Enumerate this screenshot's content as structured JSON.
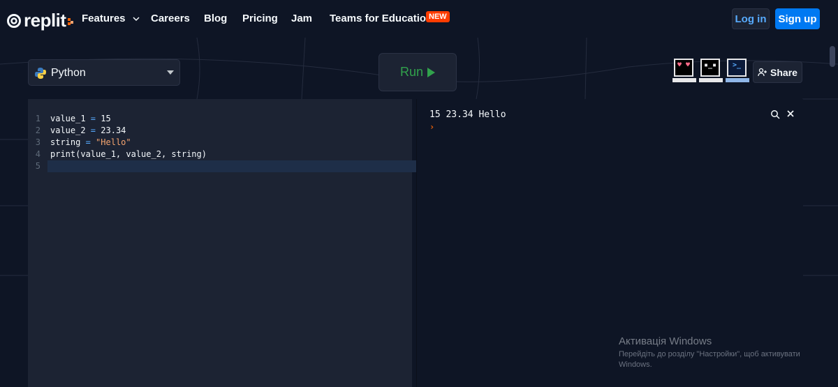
{
  "nav": {
    "logo_text": "replit",
    "links": {
      "features": "Features",
      "careers": "Careers",
      "blog": "Blog",
      "pricing": "Pricing",
      "jam": "Jam",
      "teams": "Teams for Education"
    },
    "new_badge": "NEW",
    "login": "Log in",
    "signup": "Sign up"
  },
  "toolbar": {
    "language": "Python",
    "run_label": "Run",
    "share_label": "Share",
    "avatars": [
      {
        "face": "♥ ♥",
        "icon": "heart-eyes-computer-icon"
      },
      {
        "face": "▪_▪",
        "icon": "neutral-computer-icon"
      },
      {
        "face": ">_",
        "icon": "terminal-computer-icon"
      }
    ]
  },
  "editor": {
    "lines": [
      {
        "num": "1",
        "var": "value_1",
        "op": " = ",
        "val": "15",
        "type": "num"
      },
      {
        "num": "2",
        "var": "value_2",
        "op": " = ",
        "val": "23.34",
        "type": "num"
      },
      {
        "num": "3",
        "var": "string",
        "op": " = ",
        "val": "\"Hello\"",
        "type": "str"
      },
      {
        "num": "4",
        "text": "print(value_1, value_2, string)"
      },
      {
        "num": "5",
        "text": ""
      }
    ]
  },
  "console": {
    "output": "15 23.34 Hello",
    "prompt": "›"
  },
  "watermark": {
    "title": "Активація Windows",
    "line1": "Перейдіть до розділу \"Настройки\", щоб активувати",
    "line2": "Windows."
  },
  "colors": {
    "background": "#0e1525",
    "panel": "#1c2333",
    "accent_blue": "#0079f2",
    "run_green": "#31a24c",
    "new_badge": "#ff3c00"
  }
}
